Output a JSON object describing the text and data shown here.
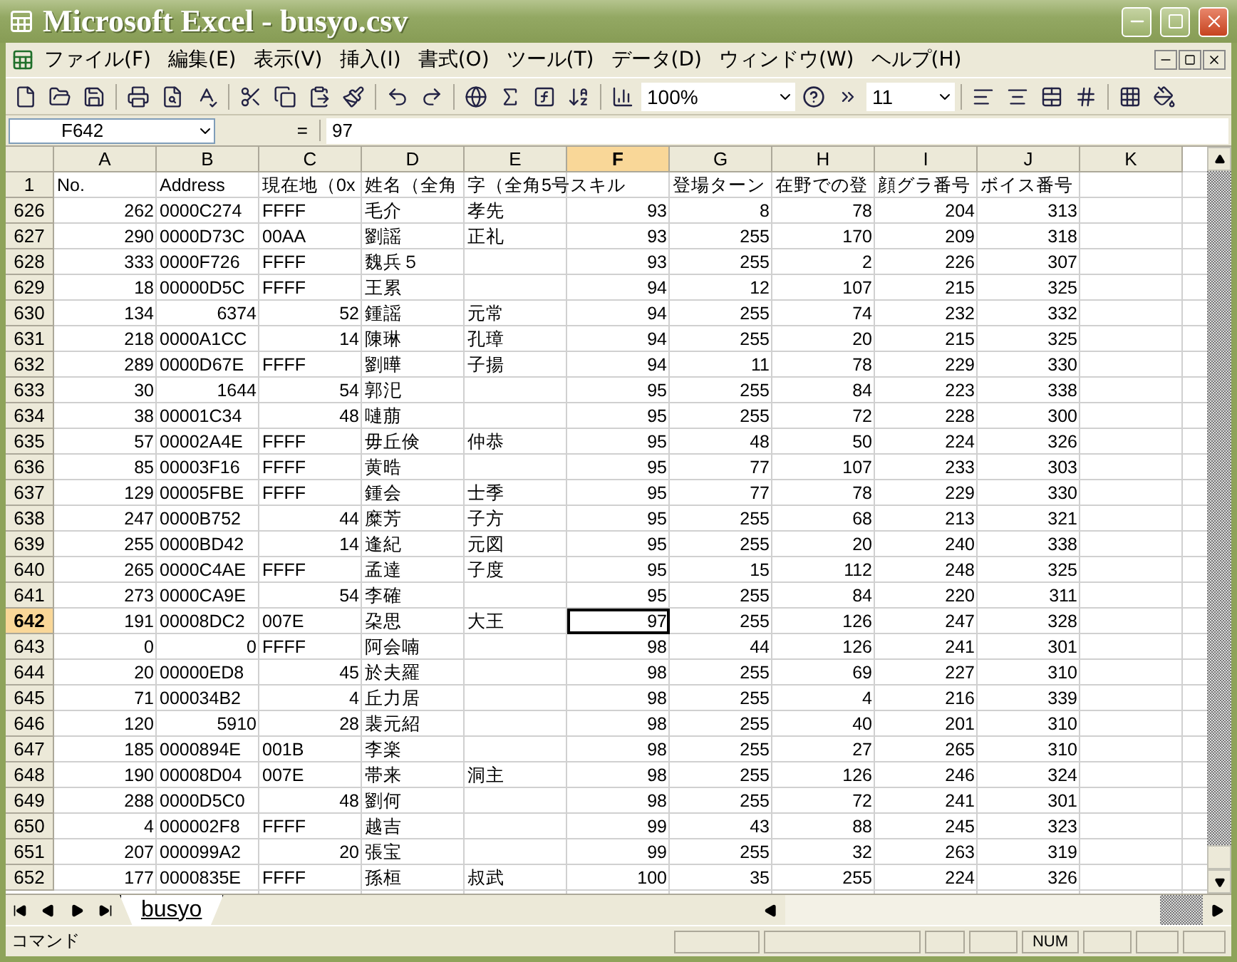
{
  "window": {
    "title": "Microsoft Excel - busyo.csv"
  },
  "menu": [
    "ファイル(F)",
    "編集(E)",
    "表示(V)",
    "挿入(I)",
    "書式(O)",
    "ツール(T)",
    "データ(D)",
    "ウィンドウ(W)",
    "ヘルプ(H)"
  ],
  "toolbar": {
    "zoom": "100%",
    "font_size": "11"
  },
  "formula_bar": {
    "name_box": "F642",
    "equals": "=",
    "value": "97"
  },
  "columns": [
    {
      "label": "A",
      "selected": false
    },
    {
      "label": "B",
      "selected": false
    },
    {
      "label": "C",
      "selected": false
    },
    {
      "label": "D",
      "selected": false
    },
    {
      "label": "E",
      "selected": false
    },
    {
      "label": "F",
      "selected": true
    },
    {
      "label": "G",
      "selected": false
    },
    {
      "label": "H",
      "selected": false
    },
    {
      "label": "I",
      "selected": false
    },
    {
      "label": "J",
      "selected": false
    },
    {
      "label": "K",
      "selected": false
    }
  ],
  "rows": [
    {
      "header": "1",
      "selected": false,
      "cells": [
        "No.",
        "Address",
        "現在地（0x",
        "姓名（全角",
        "字（全角5号",
        "スキル",
        "登場ターン",
        "在野での登",
        "顔グラ番号",
        "ボイス番号",
        null
      ]
    },
    {
      "header": "626",
      "selected": false,
      "cells": [
        "262",
        "0000C274",
        "FFFF",
        "毛介",
        "孝先",
        "93",
        "8",
        "78",
        "204",
        "313",
        null
      ]
    },
    {
      "header": "627",
      "selected": false,
      "cells": [
        "290",
        "0000D73C",
        "00AA",
        "劉謡",
        "正礼",
        "93",
        "255",
        "170",
        "209",
        "318",
        null
      ]
    },
    {
      "header": "628",
      "selected": false,
      "cells": [
        "333",
        "0000F726",
        "FFFF",
        "魏兵５",
        null,
        "93",
        "255",
        "2",
        "226",
        "307",
        null
      ]
    },
    {
      "header": "629",
      "selected": false,
      "cells": [
        "18",
        "00000D5C",
        "FFFF",
        "王累",
        null,
        "94",
        "12",
        "107",
        "215",
        "325",
        null
      ]
    },
    {
      "header": "630",
      "selected": false,
      "cells": [
        "134",
        "6374",
        "52",
        "鍾謡",
        "元常",
        "94",
        "255",
        "74",
        "232",
        "332",
        null
      ]
    },
    {
      "header": "631",
      "selected": false,
      "cells": [
        "218",
        "0000A1CC",
        "14",
        "陳琳",
        "孔璋",
        "94",
        "255",
        "20",
        "215",
        "325",
        null
      ]
    },
    {
      "header": "632",
      "selected": false,
      "cells": [
        "289",
        "0000D67E",
        "FFFF",
        "劉曄",
        "子揚",
        "94",
        "11",
        "78",
        "229",
        "330",
        null
      ]
    },
    {
      "header": "633",
      "selected": false,
      "cells": [
        "30",
        "1644",
        "54",
        "郭汜",
        null,
        "95",
        "255",
        "84",
        "223",
        "338",
        null
      ]
    },
    {
      "header": "634",
      "selected": false,
      "cells": [
        "38",
        "00001C34",
        "48",
        "嗹萠",
        null,
        "95",
        "255",
        "72",
        "228",
        "300",
        null
      ]
    },
    {
      "header": "635",
      "selected": false,
      "cells": [
        "57",
        "00002A4E",
        "FFFF",
        "毋丘倹",
        "仲恭",
        "95",
        "48",
        "50",
        "224",
        "326",
        null
      ]
    },
    {
      "header": "636",
      "selected": false,
      "cells": [
        "85",
        "00003F16",
        "FFFF",
        "黄晧",
        null,
        "95",
        "77",
        "107",
        "233",
        "303",
        null
      ]
    },
    {
      "header": "637",
      "selected": false,
      "cells": [
        "129",
        "00005FBE",
        "FFFF",
        "鍾会",
        "士季",
        "95",
        "77",
        "78",
        "229",
        "330",
        null
      ]
    },
    {
      "header": "638",
      "selected": false,
      "cells": [
        "247",
        "0000B752",
        "44",
        "糜芳",
        "子方",
        "95",
        "255",
        "68",
        "213",
        "321",
        null
      ]
    },
    {
      "header": "639",
      "selected": false,
      "cells": [
        "255",
        "0000BD42",
        "14",
        "逢紀",
        "元図",
        "95",
        "255",
        "20",
        "240",
        "338",
        null
      ]
    },
    {
      "header": "640",
      "selected": false,
      "cells": [
        "265",
        "0000C4AE",
        "FFFF",
        "孟達",
        "子度",
        "95",
        "15",
        "112",
        "248",
        "325",
        null
      ]
    },
    {
      "header": "641",
      "selected": false,
      "cells": [
        "273",
        "0000CA9E",
        "54",
        "李確",
        null,
        "95",
        "255",
        "84",
        "220",
        "311",
        null
      ]
    },
    {
      "header": "642",
      "selected": true,
      "cells": [
        "191",
        "00008DC2",
        "007E",
        "朶思",
        "大王",
        "97",
        "255",
        "126",
        "247",
        "328",
        null
      ]
    },
    {
      "header": "643",
      "selected": false,
      "cells": [
        "0",
        "0",
        "FFFF",
        "阿会喃",
        null,
        "98",
        "44",
        "126",
        "241",
        "301",
        null
      ]
    },
    {
      "header": "644",
      "selected": false,
      "cells": [
        "20",
        "00000ED8",
        "45",
        "於夫羅",
        null,
        "98",
        "255",
        "69",
        "227",
        "310",
        null
      ]
    },
    {
      "header": "645",
      "selected": false,
      "cells": [
        "71",
        "000034B2",
        "4",
        "丘力居",
        null,
        "98",
        "255",
        "4",
        "216",
        "339",
        null
      ]
    },
    {
      "header": "646",
      "selected": false,
      "cells": [
        "120",
        "5910",
        "28",
        "裴元紹",
        null,
        "98",
        "255",
        "40",
        "201",
        "310",
        null
      ]
    },
    {
      "header": "647",
      "selected": false,
      "cells": [
        "185",
        "0000894E",
        "001B",
        "李楽",
        null,
        "98",
        "255",
        "27",
        "265",
        "310",
        null
      ]
    },
    {
      "header": "648",
      "selected": false,
      "cells": [
        "190",
        "00008D04",
        "007E",
        "帯来",
        "洞主",
        "98",
        "255",
        "126",
        "246",
        "324",
        null
      ]
    },
    {
      "header": "649",
      "selected": false,
      "cells": [
        "288",
        "0000D5C0",
        "48",
        "劉何",
        null,
        "98",
        "255",
        "72",
        "241",
        "301",
        null
      ]
    },
    {
      "header": "650",
      "selected": false,
      "cells": [
        "4",
        "000002F8",
        "FFFF",
        "越吉",
        null,
        "99",
        "43",
        "88",
        "245",
        "323",
        null
      ]
    },
    {
      "header": "651",
      "selected": false,
      "cells": [
        "207",
        "000099A2",
        "20",
        "張宝",
        null,
        "99",
        "255",
        "32",
        "263",
        "319",
        null
      ]
    },
    {
      "header": "652",
      "selected": false,
      "cells": [
        "177",
        "0000835E",
        "FFFF",
        "孫桓",
        "叔武",
        "100",
        "35",
        "255",
        "224",
        "326",
        null
      ]
    }
  ],
  "sheet_tabs": [
    {
      "label": "busyo",
      "selected": true
    }
  ],
  "status_bar": {
    "mode": "コマンド",
    "indicators": [
      "NUM"
    ]
  }
}
